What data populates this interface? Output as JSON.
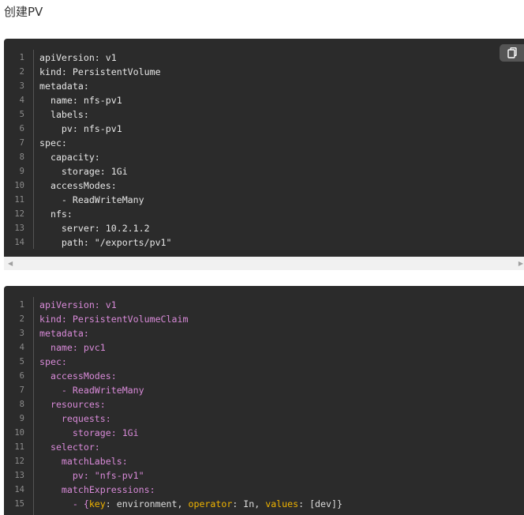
{
  "heading": "创建PV",
  "copy_button": {
    "icon": "copy-icon"
  },
  "block1": {
    "lines": [
      {
        "n": "1",
        "code": "apiVersion: v1"
      },
      {
        "n": "2",
        "code": "kind: PersistentVolume"
      },
      {
        "n": "3",
        "code": "metadata:"
      },
      {
        "n": "4",
        "code": "  name: nfs-pv1"
      },
      {
        "n": "5",
        "code": "  labels:"
      },
      {
        "n": "6",
        "code": "    pv: nfs-pv1"
      },
      {
        "n": "7",
        "code": "spec:"
      },
      {
        "n": "8",
        "code": "  capacity:"
      },
      {
        "n": "9",
        "code": "    storage: 1Gi"
      },
      {
        "n": "10",
        "code": "  accessModes:"
      },
      {
        "n": "11",
        "code": "    - ReadWriteMany"
      },
      {
        "n": "12",
        "code": "  nfs:"
      },
      {
        "n": "13",
        "code": "    server: 10.2.1.2"
      },
      {
        "n": "14",
        "code": "    path: \"/exports/pv1\""
      }
    ]
  },
  "block2": {
    "lines": [
      {
        "n": "1",
        "code": "apiVersion: v1"
      },
      {
        "n": "2",
        "code": "kind: PersistentVolumeClaim"
      },
      {
        "n": "3",
        "code": "metadata:"
      },
      {
        "n": "4",
        "code": "  name: pvc1"
      },
      {
        "n": "5",
        "code": "spec:"
      },
      {
        "n": "6",
        "code": "  accessModes:"
      },
      {
        "n": "7",
        "code": "    - ReadWriteMany"
      },
      {
        "n": "8",
        "code": "  resources:"
      },
      {
        "n": "9",
        "code": "    requests:"
      },
      {
        "n": "10",
        "code": "      storage: 1Gi"
      },
      {
        "n": "11",
        "code": "  selector:"
      },
      {
        "n": "12",
        "code": "    matchLabels:"
      },
      {
        "n": "13",
        "code": "      pv: \"nfs-pv1\""
      },
      {
        "n": "14",
        "code": "    matchExpressions:"
      }
    ],
    "last_line": {
      "n": "15",
      "prefix": "      - {",
      "k1": "key",
      "v1": ": environment, ",
      "k2": "operator",
      "v2": ": In, ",
      "k3": "values",
      "v3": ": [dev]}"
    }
  },
  "colors": {
    "code_bg": "#2b2b2b",
    "line_number": "#8c8c8c",
    "yaml_key": "#d88ad8",
    "yaml_keyword": "#f0b400"
  }
}
